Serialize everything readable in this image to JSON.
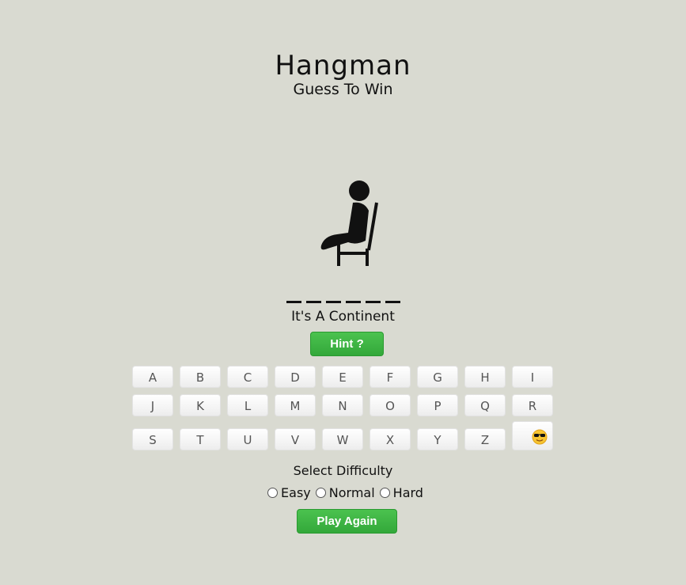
{
  "header": {
    "title": "Hangman",
    "subtitle": "Guess To Win"
  },
  "figure": {
    "icon": "person-on-chair-icon"
  },
  "word": {
    "blanks": 6,
    "revealed": [
      "",
      "",
      "",
      "",
      "",
      ""
    ]
  },
  "hint": {
    "text": "It's A Continent",
    "button_label": "Hint ?"
  },
  "keyboard": {
    "rows": [
      [
        "A",
        "B",
        "C",
        "D",
        "E",
        "F",
        "G",
        "H",
        "I"
      ],
      [
        "J",
        "K",
        "L",
        "M",
        "N",
        "O",
        "P",
        "Q",
        "R"
      ],
      [
        "S",
        "T",
        "U",
        "V",
        "W",
        "X",
        "Y",
        "Z"
      ]
    ],
    "extra_key_icon": "sunglasses-face-icon"
  },
  "difficulty": {
    "label": "Select Difficulty",
    "options": [
      "Easy",
      "Normal",
      "Hard"
    ]
  },
  "play_again_label": "Play Again",
  "colors": {
    "background": "#d9dad1",
    "accent_green": "#3cb43f"
  }
}
